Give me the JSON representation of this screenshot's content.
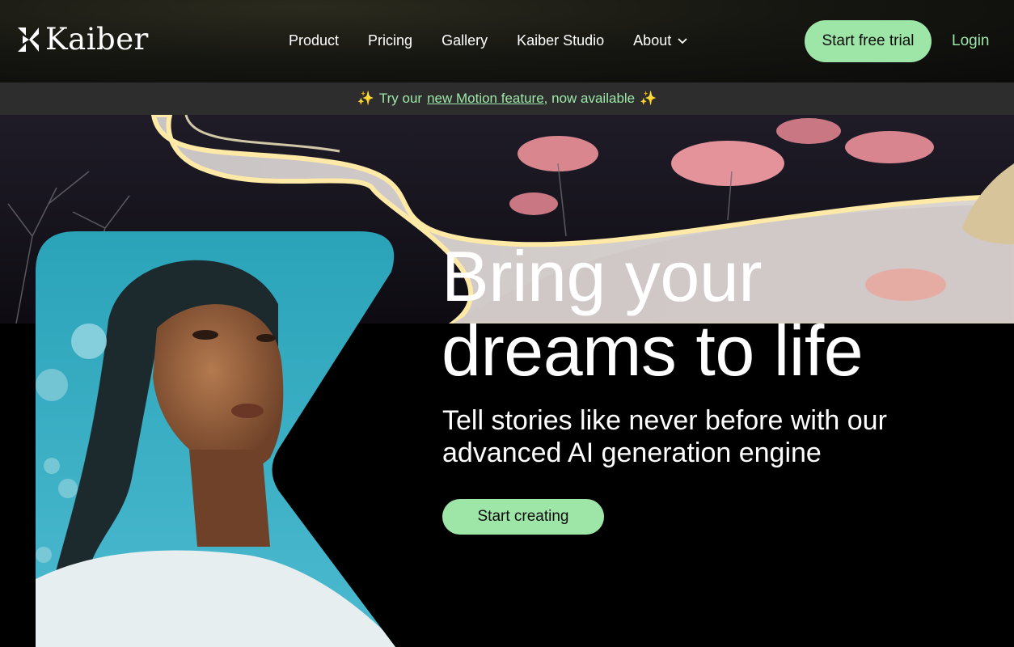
{
  "brand": {
    "name": "Kaiber"
  },
  "nav": {
    "items": [
      {
        "label": "Product"
      },
      {
        "label": "Pricing"
      },
      {
        "label": "Gallery"
      },
      {
        "label": "Kaiber Studio"
      },
      {
        "label": "About"
      }
    ]
  },
  "header": {
    "trial_label": "Start free trial",
    "login_label": "Login"
  },
  "announcement": {
    "prefix": "Try our",
    "link": "new Motion feature",
    "suffix": ", now available",
    "icon": "sparkles-icon"
  },
  "hero": {
    "title_line1": "Bring your",
    "title_line2": "dreams to life",
    "subtitle_line1": "Tell stories like never before with our",
    "subtitle_line2": "advanced AI generation engine",
    "cta_label": "Start creating"
  },
  "colors": {
    "accent": "#9ee6a8",
    "announce_bg": "#2d2d2d",
    "background": "#000000"
  }
}
